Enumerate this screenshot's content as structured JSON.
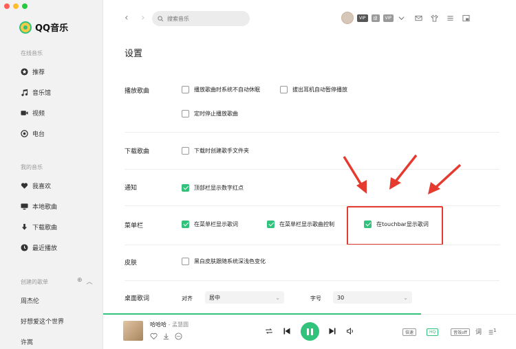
{
  "app": {
    "name": "QQ音乐"
  },
  "sidebar": {
    "online_title": "在线音乐",
    "online_items": [
      {
        "label": "推荐",
        "icon": "recommend-icon"
      },
      {
        "label": "音乐馆",
        "icon": "music-hall-icon"
      },
      {
        "label": "视频",
        "icon": "video-icon"
      },
      {
        "label": "电台",
        "icon": "radio-icon"
      }
    ],
    "mine_title": "我的音乐",
    "mine_items": [
      {
        "label": "我喜欢",
        "icon": "heart-icon"
      },
      {
        "label": "本地歌曲",
        "icon": "computer-icon"
      },
      {
        "label": "下载歌曲",
        "icon": "download-icon"
      },
      {
        "label": "最近播放",
        "icon": "clock-icon"
      }
    ],
    "created_title": "创建的歌单",
    "playlists": [
      "周杰伦",
      "好想爱这个世界",
      "许嵩"
    ]
  },
  "topbar": {
    "search_placeholder": "搜索音乐",
    "badges": [
      "VIP",
      "绿",
      "VIP"
    ]
  },
  "settings": {
    "title": "设置",
    "rows": {
      "playback": {
        "label": "播放歌曲",
        "opt1": "播放歌曲时系统不自动休眠",
        "opt2": "拔出耳机自动暂停播放",
        "opt3": "定时停止播放歌曲"
      },
      "download": {
        "label": "下载歌曲",
        "opt1": "下载时创建歌手文件夹"
      },
      "notify": {
        "label": "通知",
        "opt1": "顶部栏显示数字红点"
      },
      "menubar": {
        "label": "菜单栏",
        "opt1": "在菜单栏显示歌词",
        "opt2": "在菜单栏显示歌曲控制",
        "opt3": "在touchbar显示歌词"
      },
      "skin": {
        "label": "皮肤",
        "opt1": "黑白皮肤跟随系统深浅色变化"
      },
      "desktop_lyrics": {
        "label": "桌面歌词",
        "align_label": "对齐",
        "align_value": "居中",
        "size_label": "字号",
        "size_value": "30"
      }
    }
  },
  "player": {
    "song_title": "哈哈哈",
    "artist": " - 孟慧圆",
    "speed": "倍速",
    "quality": "HQ",
    "sound_effect": "音效off",
    "lyric": "词",
    "queue_count": "1"
  },
  "colors": {
    "accent": "#31c27c",
    "highlight": "#e53a2e"
  }
}
